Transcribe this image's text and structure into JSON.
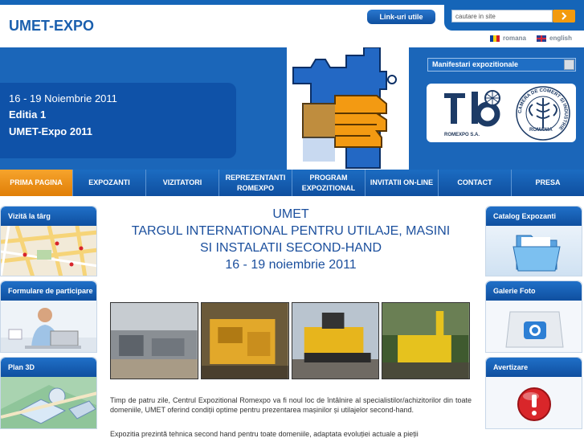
{
  "header": {
    "site_title": "UMET-EXPO",
    "links_button": "Link-uri utile",
    "search_placeholder": "cautare in site",
    "lang_romana": "romana",
    "lang_english": "english"
  },
  "banner": {
    "dates": "16 - 19 Noiembrie 2011",
    "edition": "Editia 1",
    "event": "UMET-Expo 2011",
    "manifestari_select": "Manifestari expozitionale",
    "partner_romexpo": "ROMEXPO S.A.",
    "partner_ccir_ring": "CAMERA DE COMERT SI INDUSTRIE",
    "partner_ccir_country": "ROMANIA"
  },
  "nav": {
    "items": [
      {
        "label": "PRIMA PAGINA",
        "active": true
      },
      {
        "label": "EXPOZANTI",
        "active": false
      },
      {
        "label": "VIZITATORI",
        "active": false
      },
      {
        "label": "REPREZENTANTI ROMEXPO",
        "active": false
      },
      {
        "label": "PROGRAM EXPOZITIONAL",
        "active": false
      },
      {
        "label": "INVITATII ON-LINE",
        "active": false
      },
      {
        "label": "CONTACT",
        "active": false
      },
      {
        "label": "PRESA",
        "active": false
      }
    ]
  },
  "left_sidebar": {
    "cards": [
      {
        "title": "Vizită la târg"
      },
      {
        "title": "Formulare de participare"
      },
      {
        "title": "Plan 3D"
      }
    ]
  },
  "right_sidebar": {
    "cards": [
      {
        "title": "Catalog Expozanti"
      },
      {
        "title": "Galerie Foto"
      },
      {
        "title": "Avertizare"
      }
    ]
  },
  "main": {
    "line1": "UMET",
    "line2": "TARGUL INTERNATIONAL PENTRU UTILAJE, MASINI",
    "line3": "SI INSTALATII SECOND-HAND",
    "line4": "16 - 19 noiembrie 2011",
    "paragraph1": "Timp de patru zile, Centrul Expozitional Romexpo va fi noul loc de întâlnire al specialistilor/achizitorilor din toate domeniile, UMET oferind condiții optime pentru prezentarea mașinilor și utilajelor second-hand.",
    "paragraph2": "Expozitia prezintă tehnica second hand pentru toate domeniile, adaptata evoluției actuale a pieții"
  }
}
